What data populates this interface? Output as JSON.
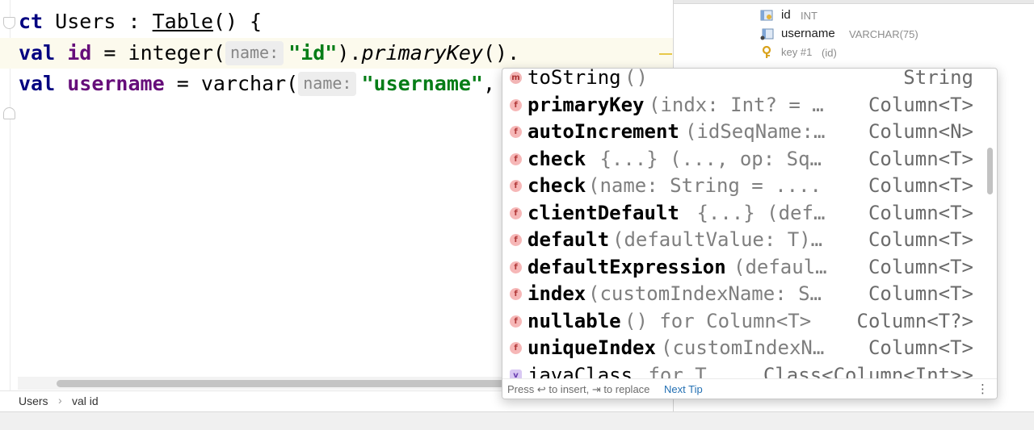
{
  "editor": {
    "line1": {
      "kw": "ct",
      "name": "Users",
      "colon": ":",
      "base": "Table",
      "rest": "() {"
    },
    "line2": {
      "kw": "val",
      "prop": "id",
      "eq": "=",
      "call": "integer(",
      "hint": "name:",
      "str": "\"id\"",
      "mid": ").",
      "method": "primaryKey",
      "end": "()."
    },
    "line3": {
      "kw": "val",
      "prop": "username",
      "eq": "=",
      "call": "varchar(",
      "hint": "name:",
      "str": "\"username\"",
      "end": ","
    }
  },
  "breadcrumb": {
    "item1": "Users",
    "sep": "›",
    "item2": "val id"
  },
  "db_tree": {
    "rows": [
      {
        "name": "id",
        "type": "INT",
        "icon": "key-column-icon"
      },
      {
        "name": "username",
        "type": "VARCHAR(75)",
        "icon": "column-icon"
      },
      {
        "name": "key #1",
        "type": "(id)",
        "icon": "key-icon"
      }
    ]
  },
  "completion": {
    "items": [
      {
        "icon": "m",
        "name": "toString",
        "tail": "()",
        "type": "String",
        "bold": false
      },
      {
        "icon": "f",
        "name": "primaryKey",
        "tail": "(indx: Int? = …",
        "type": "Column<T>",
        "bold": true
      },
      {
        "icon": "f",
        "name": "autoIncrement",
        "tail": "(idSeqName:…",
        "type": "Column<N>",
        "bold": true
      },
      {
        "icon": "f",
        "name": "check",
        "tail": " {...} (..., op: Sq…",
        "type": "Column<T>",
        "bold": true
      },
      {
        "icon": "f",
        "name": "check",
        "tail": "(name: String = ....",
        "type": "Column<T>",
        "bold": true
      },
      {
        "icon": "f",
        "name": "clientDefault",
        "tail": " {...} (def…",
        "type": "Column<T>",
        "bold": true
      },
      {
        "icon": "f",
        "name": "default",
        "tail": "(defaultValue: T)…",
        "type": "Column<T>",
        "bold": true
      },
      {
        "icon": "f",
        "name": "defaultExpression",
        "tail": "(defaul…",
        "type": "Column<T>",
        "bold": true
      },
      {
        "icon": "f",
        "name": "index",
        "tail": "(customIndexName: S…",
        "type": "Column<T>",
        "bold": true
      },
      {
        "icon": "f",
        "name": "nullable",
        "tail": "() for Column<T>",
        "type": "Column<T?>",
        "bold": true
      },
      {
        "icon": "f",
        "name": "uniqueIndex",
        "tail": "(customIndexN…",
        "type": "Column<T>",
        "bold": true
      },
      {
        "icon": "v",
        "name": "javaClass",
        "tail": " for T",
        "type": "Class<Column<Int>>",
        "bold": false
      }
    ],
    "footer_hint": "Press ↩ to insert, ⇥ to replace",
    "footer_link": "Next Tip",
    "footer_menu": "⋮"
  }
}
